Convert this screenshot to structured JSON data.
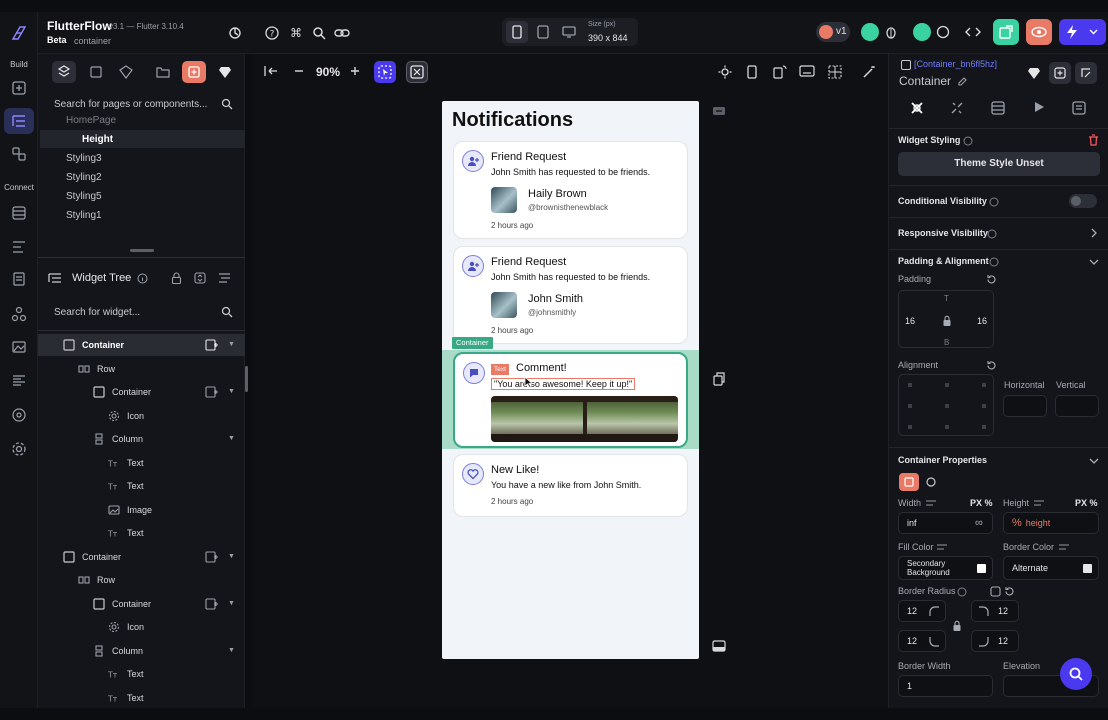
{
  "app": {
    "name": "FlutterFlow",
    "version": "v3.1 — Flutter 3.10.4",
    "channel": "Beta",
    "selected_type": "container"
  },
  "rail": {
    "build_label": "Build",
    "connect_label": "Connect"
  },
  "topbar": {
    "size_label": "Size (px)",
    "size_value": "390 x 844",
    "version_badge": "v1"
  },
  "left_panel": {
    "search_pages_placeholder": "Search for pages or components...",
    "pages": [
      "HomePage",
      "Height",
      "Styling3",
      "Styling2",
      "Styling5",
      "Styling1"
    ],
    "selected_page": "Height",
    "widget_tree_title": "Widget Tree",
    "search_widget_placeholder": "Search for widget...",
    "tree": [
      {
        "label": "Container",
        "depth": 0,
        "icon": "container-icon",
        "selected": true
      },
      {
        "label": "Row",
        "depth": 1,
        "icon": "row-icon"
      },
      {
        "label": "Container",
        "depth": 2,
        "icon": "container-icon"
      },
      {
        "label": "Icon",
        "depth": 3,
        "icon": "gear-icon"
      },
      {
        "label": "Column",
        "depth": 2,
        "icon": "column-icon"
      },
      {
        "label": "Text",
        "depth": 3,
        "icon": "text-icon"
      },
      {
        "label": "Text",
        "depth": 3,
        "icon": "text-icon"
      },
      {
        "label": "Image",
        "depth": 3,
        "icon": "image-icon"
      },
      {
        "label": "Text",
        "depth": 3,
        "icon": "text-icon"
      },
      {
        "label": "Container",
        "depth": 0,
        "icon": "container-icon"
      },
      {
        "label": "Row",
        "depth": 1,
        "icon": "row-icon"
      },
      {
        "label": "Container",
        "depth": 2,
        "icon": "container-icon"
      },
      {
        "label": "Icon",
        "depth": 3,
        "icon": "gear-icon"
      },
      {
        "label": "Column",
        "depth": 2,
        "icon": "column-icon"
      },
      {
        "label": "Text",
        "depth": 3,
        "icon": "text-icon"
      },
      {
        "label": "Text",
        "depth": 3,
        "icon": "text-icon"
      }
    ]
  },
  "canvas": {
    "zoom": "90%",
    "container_tag": "Container",
    "text_tag": "Text",
    "screen_title": "Notifications",
    "cards": [
      {
        "title": "Friend Request",
        "body": "John Smith has requested to be friends.",
        "name": "Haily Brown",
        "handle": "@brownisthenewblack",
        "time": "2 hours ago"
      },
      {
        "title": "Friend Request",
        "body": "John Smith has requested to be friends.",
        "name": "John Smith",
        "handle": "@johnsmithly",
        "time": "2 hours ago"
      },
      {
        "title": "Comment!",
        "body": "\"You are so awesome! Keep it up!\""
      },
      {
        "title": "New Like!",
        "body": "You have a new like from John Smith.",
        "time": "2 hours ago"
      }
    ]
  },
  "right_panel": {
    "widget_id": "[Container_bn6fl5hz]",
    "widget_type": "Container",
    "widget_styling": "Widget Styling",
    "theme_style": "Theme Style Unset",
    "conditional_visibility": "Conditional Visibility",
    "responsive_visibility": "Responsive Visibility",
    "padding_alignment": "Padding & Alignment",
    "padding_label": "Padding",
    "pad_top": "T",
    "pad_bottom": "B",
    "pad_left": "16",
    "pad_right": "16",
    "alignment_label": "Alignment",
    "horizontal_label": "Horizontal",
    "vertical_label": "Vertical",
    "container_properties": "Container Properties",
    "width_label": "Width",
    "width_unit": "PX %",
    "width_value": "inf",
    "width_inf_symbol": "∞",
    "height_label": "Height",
    "height_unit": "PX %",
    "height_value": "height",
    "fill_color_label": "Fill Color",
    "fill_color_value": "Secondary Background",
    "border_color_label": "Border Color",
    "border_color_value": "Alternate",
    "border_radius_label": "Border Radius",
    "radius_tl": "12",
    "radius_tr": "12",
    "radius_bl": "12",
    "radius_br": "12",
    "border_width_label": "Border Width",
    "border_width_value": "1",
    "elevation_label": "Elevation"
  },
  "colors": {
    "accent": "#4b39ef",
    "highlight": "#e87a66",
    "selection_green": "#39d2a0"
  }
}
